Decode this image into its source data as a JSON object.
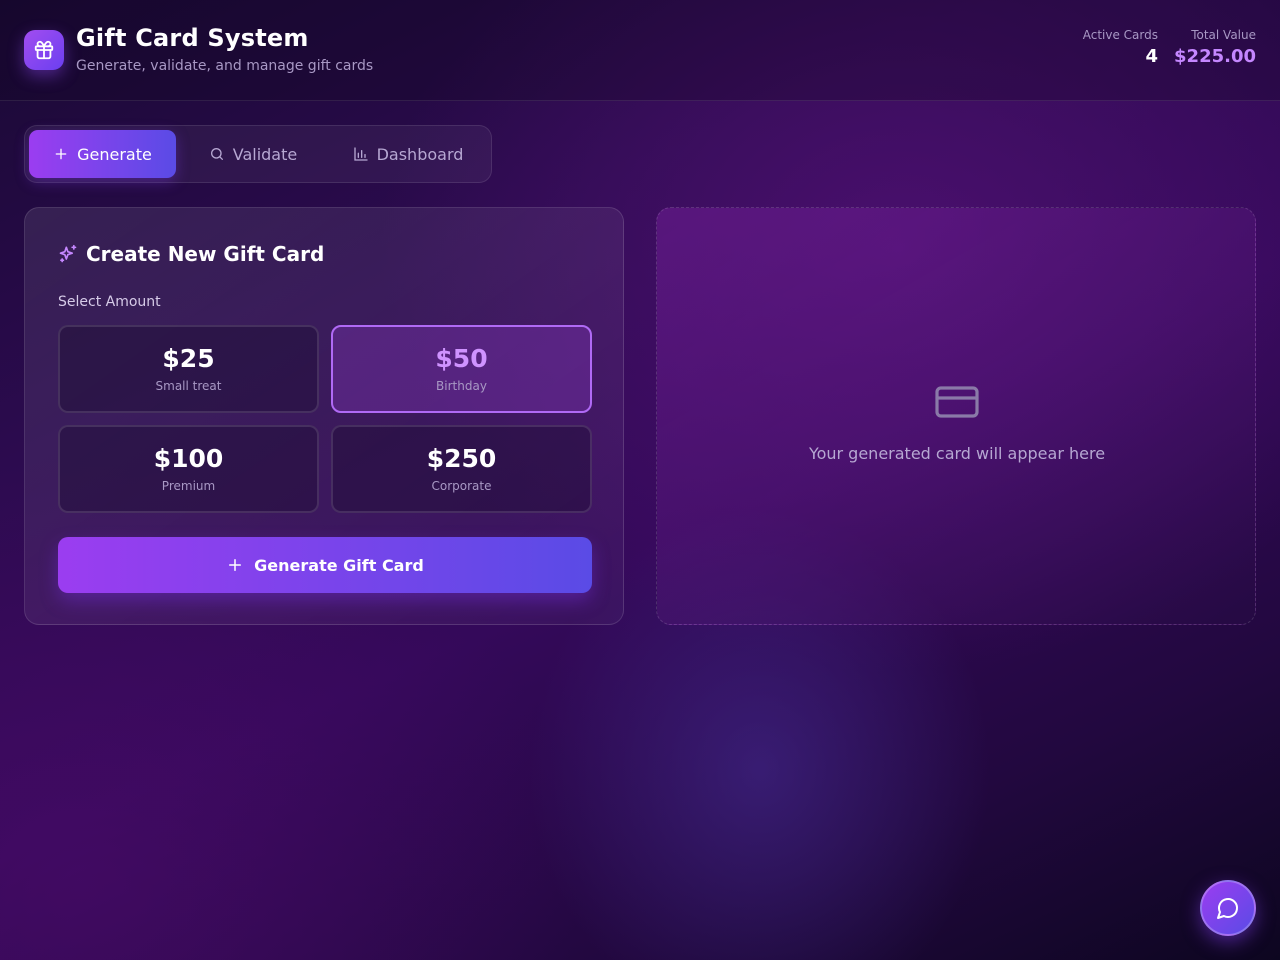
{
  "header": {
    "title": "Gift Card System",
    "subtitle": "Generate, validate, and manage gift cards",
    "logo_icon": "gift-icon",
    "stats": {
      "active_label": "Active Cards",
      "active_value": "4",
      "total_label": "Total Value",
      "total_value": "$225.00"
    }
  },
  "tabs": [
    {
      "label": "Generate",
      "icon": "plus-icon",
      "active": true
    },
    {
      "label": "Validate",
      "icon": "search-icon",
      "active": false
    },
    {
      "label": "Dashboard",
      "icon": "bar-chart-icon",
      "active": false
    }
  ],
  "create_panel": {
    "title": "Create New Gift Card",
    "title_icon": "sparkles-icon",
    "amount_label": "Select Amount",
    "amounts": [
      {
        "value": "$25",
        "desc": "Small treat",
        "selected": false
      },
      {
        "value": "$50",
        "desc": "Birthday",
        "selected": true
      },
      {
        "value": "$100",
        "desc": "Premium",
        "selected": false
      },
      {
        "value": "$250",
        "desc": "Corporate",
        "selected": false
      }
    ],
    "generate_button": "Generate Gift Card"
  },
  "preview_panel": {
    "icon": "credit-card-icon",
    "placeholder": "Your generated card will appear here"
  },
  "chat_button": {
    "icon": "chat-bubble-icon"
  },
  "colors": {
    "accent_start": "#9b3df0",
    "accent_end": "#5a4be6",
    "highlight": "#c587ff",
    "muted_text": "#a898c4"
  }
}
